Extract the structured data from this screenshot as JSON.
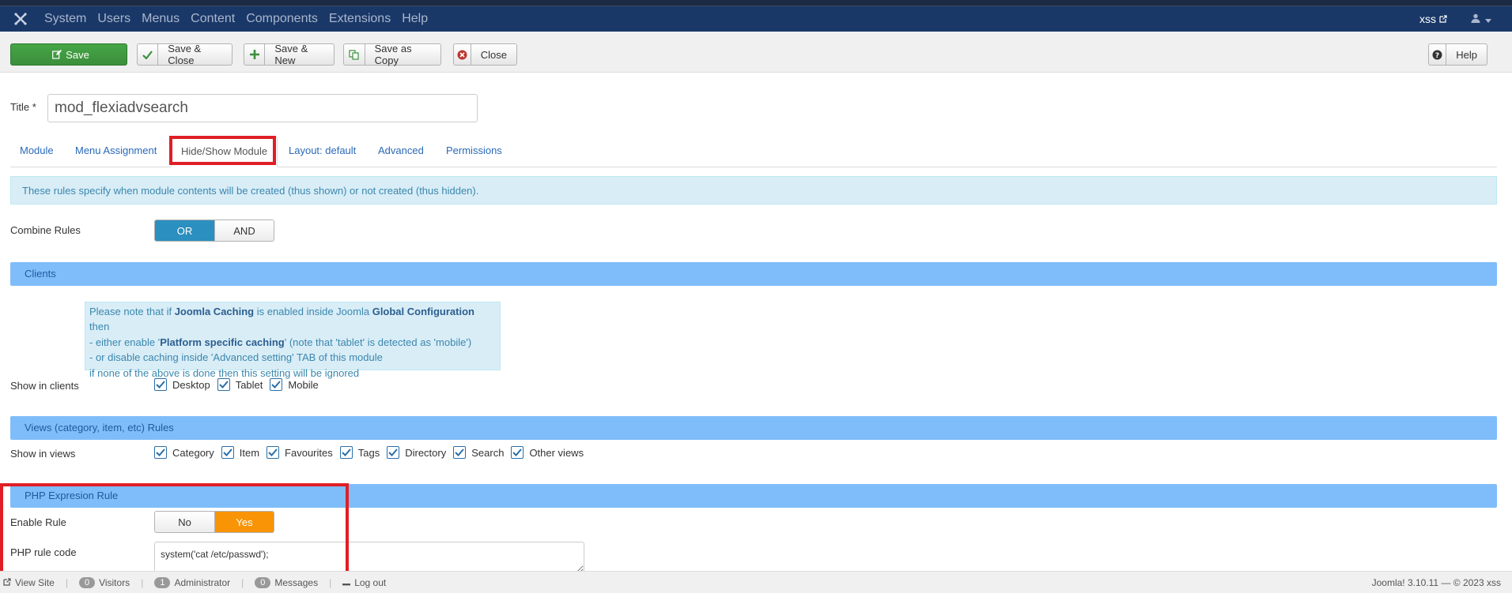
{
  "navbar": {
    "menu": [
      "System",
      "Users",
      "Menus",
      "Content",
      "Components",
      "Extensions",
      "Help"
    ],
    "site_link": "xss",
    "colors": {
      "background": "#1a3867",
      "menu_text": "#a9b6ce"
    }
  },
  "toolbar": {
    "save": "Save",
    "save_close": "Save & Close",
    "save_new": "Save & New",
    "save_copy": "Save as Copy",
    "close": "Close",
    "help": "Help"
  },
  "form": {
    "title_label": "Title *",
    "title_value": "mod_flexiadvsearch"
  },
  "tabs": [
    "Module",
    "Menu Assignment",
    "Hide/Show Module",
    "Layout: default",
    "Advanced",
    "Permissions"
  ],
  "active_tab": "Hide/Show Module",
  "rules_info": "These rules specify when module contents will be created (thus shown) or not created (thus hidden).",
  "combine": {
    "label": "Combine Rules",
    "options": [
      "OR",
      "AND"
    ],
    "selected": "OR"
  },
  "clients": {
    "heading": "Clients",
    "note": {
      "l1_a": "Please note that if ",
      "l1_b": "Joomla Caching",
      "l1_c": " is enabled inside Joomla ",
      "l1_d": "Global Configuration",
      "l1_e": " then",
      "l2_a": "- either enable '",
      "l2_b": "Platform specific caching",
      "l2_c": "' (note that 'tablet' is detected as 'mobile')",
      "l3": "- or disable caching inside 'Advanced setting' TAB of this module",
      "l4": "if none of the above is done then this setting will be ignored"
    },
    "label": "Show in clients",
    "options": [
      "Desktop",
      "Tablet",
      "Mobile"
    ]
  },
  "views": {
    "heading": "Views (category, item, etc) Rules",
    "label": "Show in views",
    "options": [
      "Category",
      "Item",
      "Favourites",
      "Tags",
      "Directory",
      "Search",
      "Other views"
    ]
  },
  "php": {
    "heading": "PHP Expresion Rule",
    "enable_label": "Enable Rule",
    "options": [
      "No",
      "Yes"
    ],
    "selected": "Yes",
    "code_label": "PHP rule code",
    "code_value": "system('cat /etc/passwd');"
  },
  "statusbar": {
    "view_site": "View Site",
    "visitors_count": "0",
    "visitors": "Visitors",
    "admin_count": "1",
    "admin": "Administrator",
    "messages_count": "0",
    "messages": "Messages",
    "logout": "Log out",
    "version": "Joomla! 3.10.11",
    "copyright": "© 2023 xss"
  },
  "colors": {
    "save_button": "#46a546",
    "section_bar": "#7fbdfa",
    "highlight": "#e01e25",
    "toggle_on_blue": "#2b8fbf",
    "toggle_on_orange": "#f89406"
  }
}
